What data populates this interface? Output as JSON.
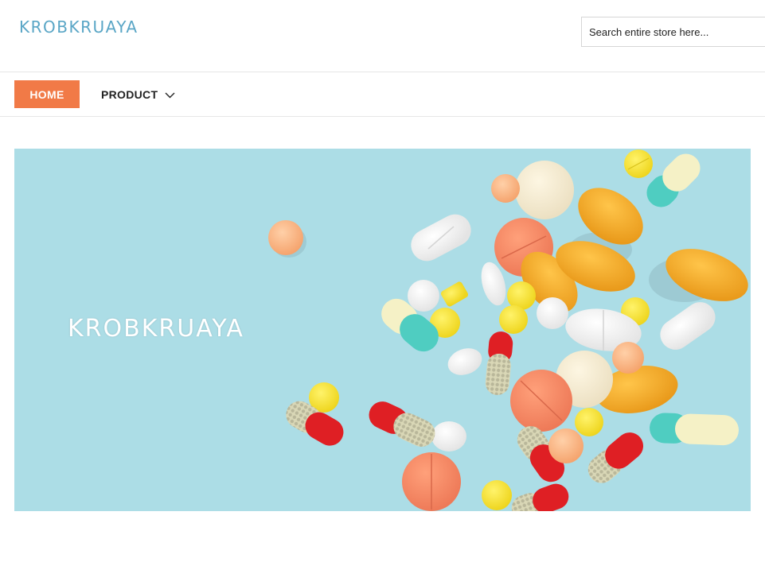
{
  "header": {
    "logo_text": "KROBKRUAYA",
    "search": {
      "placeholder": "Search entire store here..."
    }
  },
  "nav": {
    "items": [
      {
        "label": "HOME",
        "active": true
      },
      {
        "label": "PRODUCT",
        "has_dropdown": true
      }
    ]
  },
  "banner": {
    "title": "KROBKRUAYA",
    "background_color": "#acdde6"
  },
  "colors": {
    "accent": "#f17a47",
    "logo": "#5aa6c6"
  },
  "icons": {
    "dropdown": "chevron-down-icon"
  }
}
